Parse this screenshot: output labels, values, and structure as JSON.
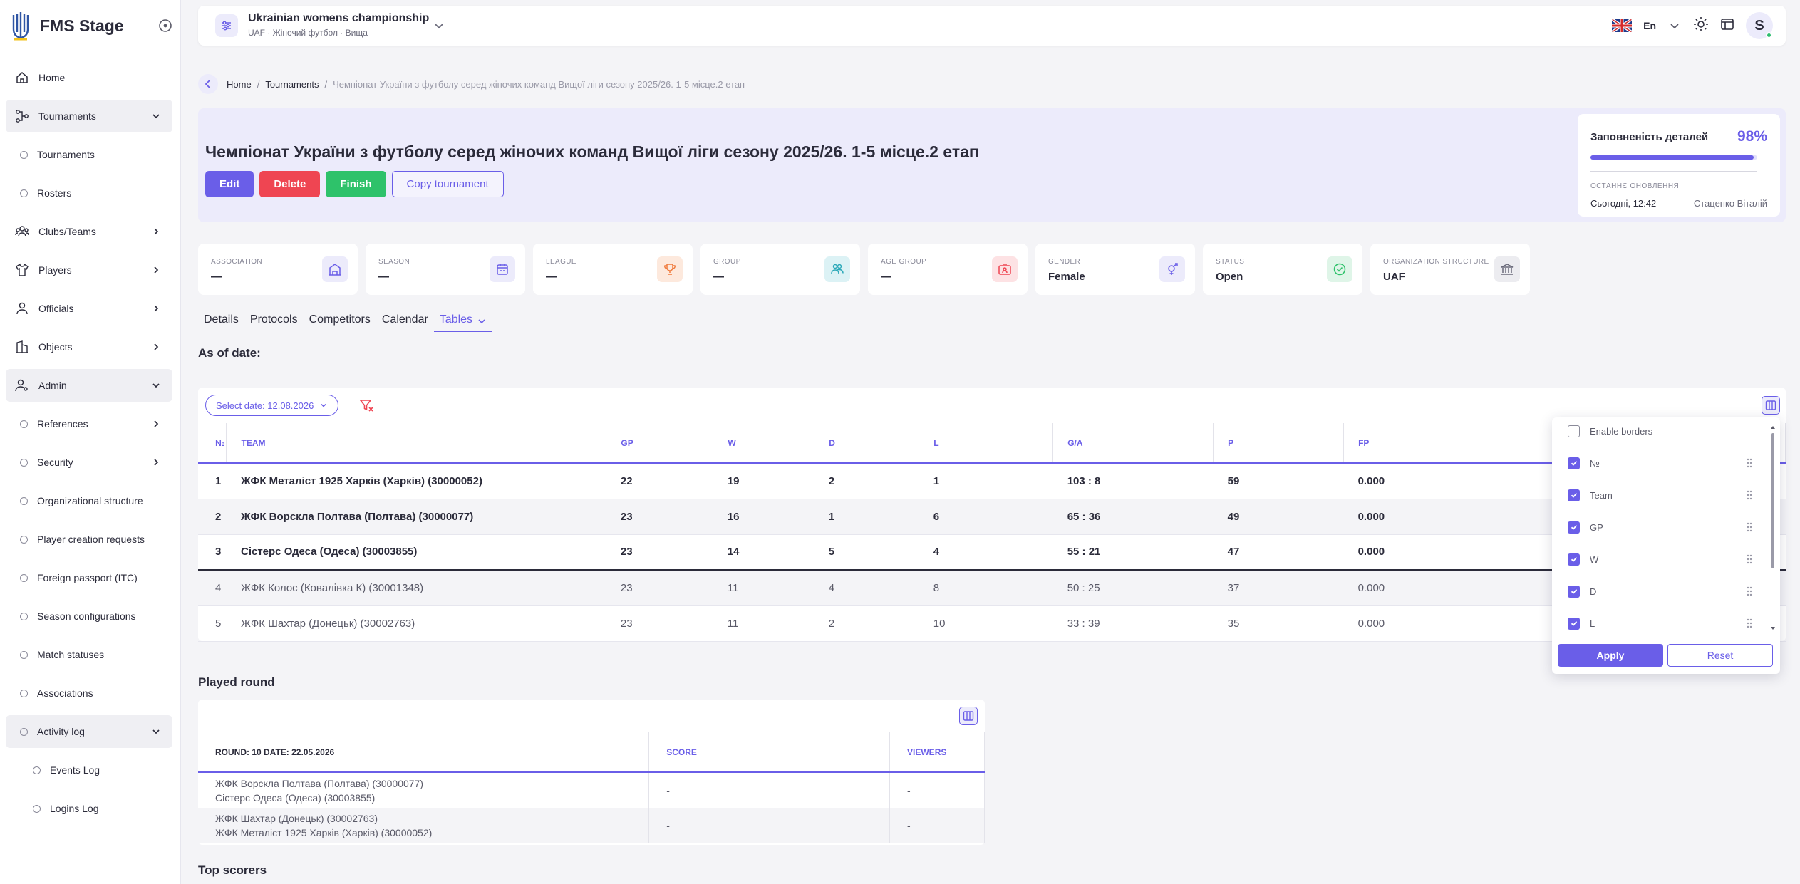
{
  "brand": {
    "name": "FMS Stage"
  },
  "sidebar": {
    "items": [
      {
        "label": "Home",
        "icon": "home-icon",
        "type": "top",
        "active": false
      },
      {
        "label": "Tournaments",
        "icon": "tournament-icon",
        "type": "top",
        "active": true,
        "chevron": "down"
      },
      {
        "label": "Tournaments",
        "type": "sub"
      },
      {
        "label": "Rosters",
        "type": "sub"
      },
      {
        "label": "Clubs/Teams",
        "icon": "teams-icon",
        "type": "top",
        "chevron": "right"
      },
      {
        "label": "Players",
        "icon": "shirt-icon",
        "type": "top",
        "chevron": "right"
      },
      {
        "label": "Officials",
        "icon": "official-icon",
        "type": "top",
        "chevron": "right"
      },
      {
        "label": "Objects",
        "icon": "building-icon",
        "type": "top",
        "chevron": "right"
      },
      {
        "label": "Admin",
        "icon": "admin-icon",
        "type": "top",
        "active": true,
        "chevron": "down"
      },
      {
        "label": "References",
        "type": "sub",
        "chevron": "right"
      },
      {
        "label": "Security",
        "type": "sub",
        "chevron": "right"
      },
      {
        "label": "Organizational structure",
        "type": "sub"
      },
      {
        "label": "Player creation requests",
        "type": "sub"
      },
      {
        "label": "Foreign passport (ITC)",
        "type": "sub"
      },
      {
        "label": "Season configurations",
        "type": "sub"
      },
      {
        "label": "Match statuses",
        "type": "sub"
      },
      {
        "label": "Associations",
        "type": "sub"
      },
      {
        "label": "Activity log",
        "type": "sub",
        "active": true,
        "chevron": "down"
      },
      {
        "label": "Events Log",
        "type": "child"
      },
      {
        "label": "Logins Log",
        "type": "child"
      }
    ]
  },
  "header": {
    "title": "Ukrainian womens championship",
    "subtitle": "UAF · Жіночий футбол · Вища",
    "language": "En",
    "avatar_letter": "S"
  },
  "breadcrumb": {
    "home": "Home",
    "tournaments": "Tournaments",
    "current": "Чемпіонат України з футболу серед жіночих команд Вищої ліги сезону 2025/26. 1-5 місце.2 етап"
  },
  "hero": {
    "title": "Чемпіонат України з футболу серед жіночих команд Вищої ліги сезону 2025/26. 1-5 місце.2 етап",
    "buttons": {
      "edit": "Edit",
      "delete": "Delete",
      "finish": "Finish",
      "copy": "Copy tournament"
    },
    "completeness": {
      "label": "Заповненість деталей",
      "percent_text": "98%",
      "percent": 98,
      "last_update_label": "ОСТАННЄ ОНОВЛЕННЯ",
      "last_update_date": "Сьогодні, 12:42",
      "last_update_user": "Стаценко Віталій"
    }
  },
  "info_cards": [
    {
      "label": "ASSOCIATION",
      "value": "—",
      "icon": "building-icon",
      "color": "#6a5ee8",
      "bg": "#ecebfb"
    },
    {
      "label": "SEASON",
      "value": "—",
      "icon": "calendar-icon",
      "color": "#6a5ee8",
      "bg": "#ecebfb"
    },
    {
      "label": "LEAGUE",
      "value": "—",
      "icon": "trophy-icon",
      "color": "#f07a3c",
      "bg": "#fde9dd"
    },
    {
      "label": "GROUP",
      "value": "—",
      "icon": "group-icon",
      "color": "#2aa8b8",
      "bg": "#dcf2f5"
    },
    {
      "label": "AGE GROUP",
      "value": "—",
      "icon": "id-card-icon",
      "color": "#ef4552",
      "bg": "#fde2e4"
    },
    {
      "label": "GENDER",
      "value": "Female",
      "icon": "gender-icon",
      "color": "#6a5ee8",
      "bg": "#ecebfb"
    },
    {
      "label": "STATUS",
      "value": "Open",
      "icon": "check-circle-icon",
      "color": "#2ec26a",
      "bg": "#dff5e8"
    },
    {
      "label": "ORGANIZATION STRUCTURE",
      "value": "UAF",
      "icon": "bank-icon",
      "color": "#6b6b7b",
      "bg": "#ececf0"
    }
  ],
  "tabs": [
    "Details",
    "Protocols",
    "Competitors",
    "Calendar",
    "Tables"
  ],
  "as_of": {
    "heading": "As of date:",
    "date_select": "Select date: 12.08.2026"
  },
  "standings": {
    "columns": [
      "№",
      "TEAM",
      "GP",
      "W",
      "D",
      "L",
      "G/A",
      "P",
      "FP"
    ],
    "rows": [
      [
        "1",
        "ЖФК Металіст 1925 Харків (Харків) (30000052)",
        "22",
        "19",
        "2",
        "1",
        "103 : 8",
        "59",
        "0.000"
      ],
      [
        "2",
        "ЖФК Ворскла Полтава (Полтава) (30000077)",
        "23",
        "16",
        "1",
        "6",
        "65 : 36",
        "49",
        "0.000"
      ],
      [
        "3",
        "Сістерс Одеса (Одеса) (30003855)",
        "23",
        "14",
        "5",
        "4",
        "55 : 21",
        "47",
        "0.000"
      ],
      [
        "4",
        "ЖФК Колос (Ковалівка К) (30001348)",
        "23",
        "11",
        "4",
        "8",
        "50 : 25",
        "37",
        "0.000"
      ],
      [
        "5",
        "ЖФК Шахтар (Донецьк) (30002763)",
        "23",
        "11",
        "2",
        "10",
        "33 : 39",
        "35",
        "0.000"
      ]
    ]
  },
  "column_picker": {
    "enable_borders": "Enable borders",
    "items": [
      "№",
      "Team",
      "GP",
      "W",
      "D",
      "L"
    ],
    "apply": "Apply",
    "reset": "Reset"
  },
  "played_round": {
    "heading": "Played round",
    "columns": [
      "ROUND: 10 DATE: 22.05.2026",
      "SCORE",
      "VIEWERS"
    ],
    "rows": [
      {
        "home": "ЖФК Ворскла Полтава (Полтава) (30000077)",
        "away": "Сістерс Одеса (Одеса) (30003855)",
        "score": "-",
        "viewers": "-"
      },
      {
        "home": "ЖФК Шахтар (Донецьк) (30002763)",
        "away": "ЖФК Металіст 1925 Харків (Харків) (30000052)",
        "score": "-",
        "viewers": "-"
      }
    ]
  },
  "top_scorers": {
    "heading": "Top scorers"
  },
  "colors": {
    "accent": "#6a5ee8",
    "danger": "#ef4552",
    "success": "#2ec26a"
  }
}
